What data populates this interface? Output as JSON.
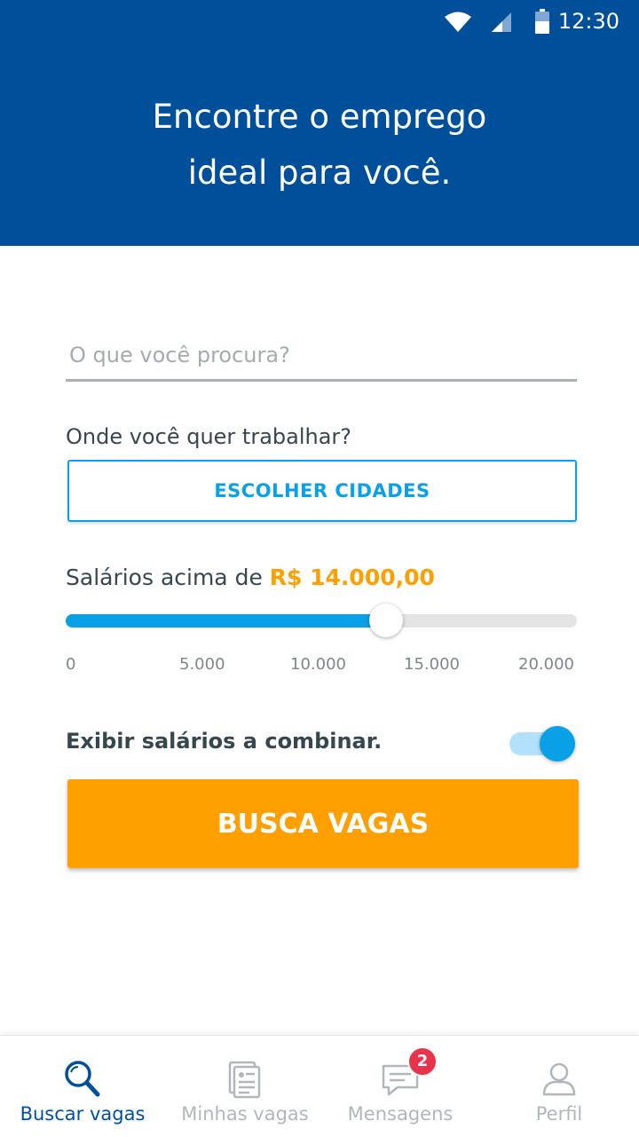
{
  "status_bar": {
    "time": "12:30"
  },
  "header": {
    "line1": "Encontre o emprego",
    "line2": "ideal para você."
  },
  "search": {
    "placeholder": "O que você procura?"
  },
  "location": {
    "label": "Onde você quer trabalhar?",
    "button_label": "ESCOLHER CIDADES"
  },
  "salary": {
    "label": "Salários acima de",
    "value_text": "R$ 14.000,00",
    "value": 14000,
    "min": 0,
    "max": 20000,
    "ticks": [
      "0",
      "5.000",
      "10.000",
      "15.000",
      "20.000"
    ]
  },
  "toggle": {
    "label": "Exibir salários a combinar.",
    "on": true
  },
  "search_button": {
    "label": "BUSCA VAGAS"
  },
  "bottom_nav": {
    "items": [
      {
        "label": "Buscar vagas",
        "icon": "search-icon",
        "active": true
      },
      {
        "label": "Minhas vagas",
        "icon": "document-icon",
        "active": false
      },
      {
        "label": "Mensagens",
        "icon": "chat-icon",
        "active": false,
        "badge": "2"
      },
      {
        "label": "Perfil",
        "icon": "user-icon",
        "active": false
      }
    ]
  },
  "colors": {
    "primary": "#004f9a",
    "accent": "#0aa0e8",
    "orange": "#ffa000",
    "badge": "#e8334a"
  }
}
